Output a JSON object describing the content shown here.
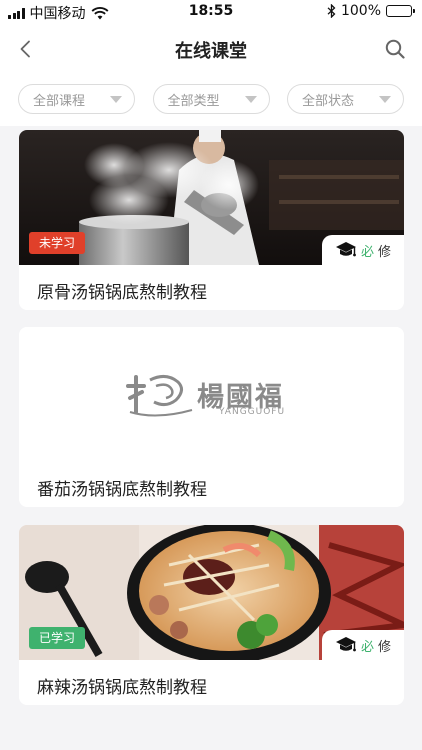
{
  "status_bar": {
    "carrier": "中国移动",
    "time": "18:55",
    "battery": "100%"
  },
  "nav": {
    "title": "在线课堂"
  },
  "filters": [
    {
      "label": "全部课程"
    },
    {
      "label": "全部类型"
    },
    {
      "label": "全部状态"
    }
  ],
  "courses": [
    {
      "title": "原骨汤锅锅底熬制教程",
      "status": "未学习",
      "required_prefix": "必",
      "required_suffix": "修"
    },
    {
      "title": "番茄汤锅锅底熬制教程",
      "logo_main": "楊國福",
      "logo_sub": "YANGGUOFU"
    },
    {
      "title": "麻辣汤锅锅底熬制教程",
      "status": "已学习",
      "required_prefix": "必",
      "required_suffix": "修"
    }
  ]
}
